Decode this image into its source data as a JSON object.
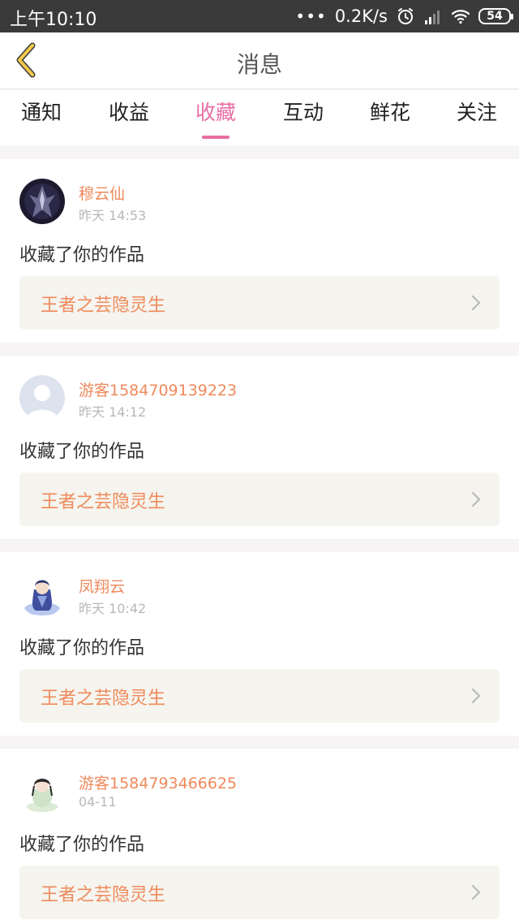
{
  "status_bar": {
    "time": "上午10:10",
    "dots": "•••",
    "speed": "0.2K/s",
    "battery": "54"
  },
  "header": {
    "title": "消息"
  },
  "tabs": [
    {
      "label": "通知"
    },
    {
      "label": "收益"
    },
    {
      "label": "收藏"
    },
    {
      "label": "互动"
    },
    {
      "label": "鲜花"
    },
    {
      "label": "关注"
    }
  ],
  "active_tab": "收藏",
  "feed": [
    {
      "name": "穆云仙",
      "time": "昨天 14:53",
      "action": "收藏了你的作品",
      "work": "王者之芸隐灵生"
    },
    {
      "name": "游客1584709139223",
      "time": "昨天 14:12",
      "action": "收藏了你的作品",
      "work": "王者之芸隐灵生"
    },
    {
      "name": "凤翔云",
      "time": "昨天 10:42",
      "action": "收藏了你的作品",
      "work": "王者之芸隐灵生"
    },
    {
      "name": "游客1584793466625",
      "time": "04-11",
      "action": "收藏了你的作品",
      "work": "王者之芸隐灵生"
    }
  ],
  "colors": {
    "accent": "#e86da3",
    "name": "#ef8a5c",
    "back_icon": "#f2c94c"
  }
}
